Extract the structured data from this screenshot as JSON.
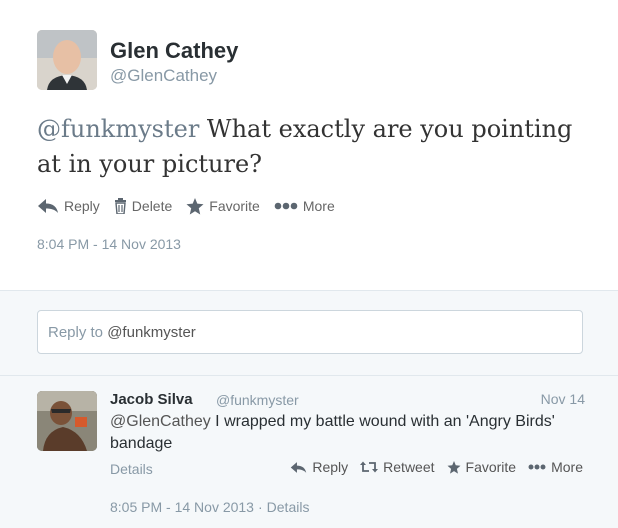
{
  "tweet": {
    "name": "Glen Cathey",
    "handle": "@GlenCathey",
    "text_mention": "@funkmyster",
    "text_body": " What exactly are you pointing at in your picture?",
    "actions": {
      "reply": "Reply",
      "delete": "Delete",
      "favorite": "Favorite",
      "more": "More"
    },
    "timestamp": "8:04 PM - 14 Nov 2013"
  },
  "reply_box": {
    "prefix": "Reply to ",
    "mention": "@funkmyster"
  },
  "reply": {
    "name": "Jacob Silva",
    "handle": "@funkmyster",
    "date": "Nov 14",
    "text_mention": "@GlenCathey",
    "text_body": " I wrapped my battle wound with an 'Angry Birds' bandage",
    "details": "Details",
    "actions": {
      "reply": "Reply",
      "retweet": "Retweet",
      "favorite": "Favorite",
      "more": "More"
    },
    "timestamp": "8:05 PM - 14 Nov 2013",
    "separator": "·",
    "details2": "Details"
  }
}
